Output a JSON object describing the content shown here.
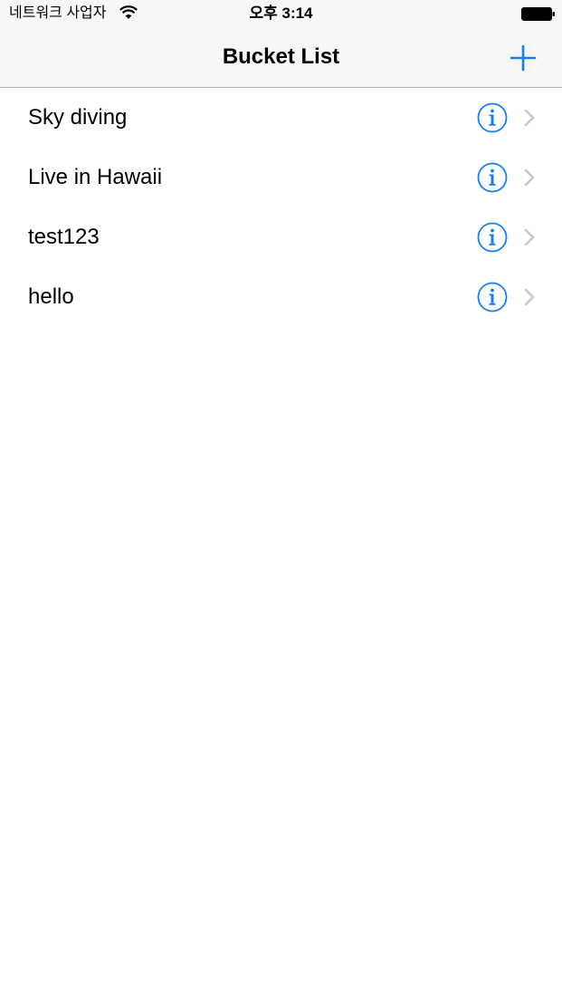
{
  "status_bar": {
    "carrier": "네트워크 사업자",
    "time": "오후 3:14"
  },
  "nav": {
    "title": "Bucket List",
    "add_icon": "plus-icon"
  },
  "list": {
    "items": [
      {
        "label": "Sky diving"
      },
      {
        "label": "Live in Hawaii"
      },
      {
        "label": "test123"
      },
      {
        "label": "hello"
      }
    ]
  },
  "colors": {
    "accent": "#157efb",
    "chevron": "#c7c7cc",
    "bar_background": "#f7f7f7",
    "separator": "#b2b2b2"
  }
}
